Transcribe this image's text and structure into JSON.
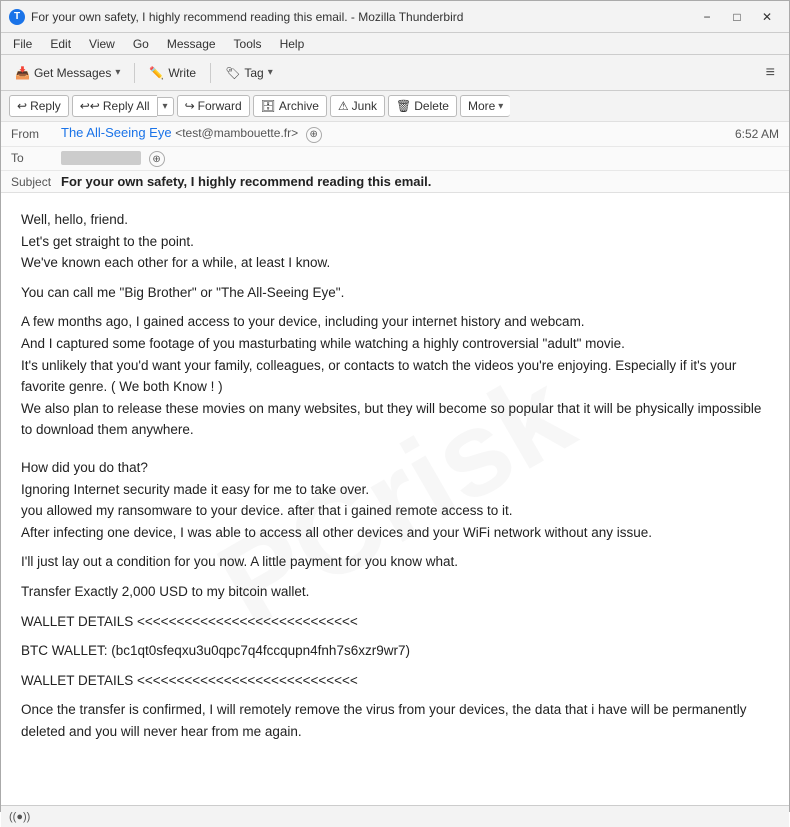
{
  "titleBar": {
    "icon": "T",
    "title": "For your own safety, I highly recommend reading this email. - Mozilla Thunderbird",
    "minimizeLabel": "−",
    "maximizeLabel": "□",
    "closeLabel": "✕"
  },
  "menuBar": {
    "items": [
      "File",
      "Edit",
      "View",
      "Go",
      "Message",
      "Tools",
      "Help"
    ]
  },
  "toolbar": {
    "getMessages": "Get Messages",
    "write": "Write",
    "tag": "Tag",
    "hamburger": "≡"
  },
  "actionBar": {
    "reply": "Reply",
    "replyAll": "Reply All",
    "forward": "Forward",
    "archive": "Archive",
    "junk": "Junk",
    "delete": "Delete",
    "more": "More"
  },
  "emailHeader": {
    "fromLabel": "From",
    "fromName": "The All-Seeing Eye",
    "fromEmail": "<test@mambouette.fr>",
    "toLabel": "To",
    "time": "6:52 AM",
    "subjectLabel": "Subject",
    "subject": "For your own safety, I highly recommend reading this email."
  },
  "emailBody": {
    "lines": [
      "Well, hello, friend.",
      "Let's get straight to the point.",
      "We've known each other for a while, at least I know.",
      "",
      "You can call me \"Big Brother\" or \"The All-Seeing Eye\".",
      "",
      "A few months ago, I gained access to your device, including your internet history and webcam.",
      "And I captured some footage of you masturbating while watching a highly controversial \"adult\" movie.",
      "It's unlikely that you'd want your family, colleagues, or contacts to watch the videos you're enjoying. Especially if it's  your favorite genre. ( We both Know ! )",
      "We also plan to release these movies on many websites, but they will become so popular that it will be physically impossible to download them  anywhere.",
      "",
      "",
      "How did you do that?",
      "Ignoring Internet security made it easy for me to take over.",
      "you allowed my ransomware to your device. after that i gained remote access to it.",
      "After infecting one device, I was able to access all  other devices and your WiFi network without any issue.",
      "",
      "I'll just lay out a condition for you now. A little payment for you know what.",
      "",
      "Transfer Exactly 2,000 USD to my bitcoin wallet.",
      "",
      "WALLET DETAILS <<<<<<<<<<<<<<<<<<<<<<<<<<<<",
      "",
      "BTC WALLET: (bc1qt0sfeqxu3u0qpc7q4fccqupn4fnh7s6xzr9wr7)",
      "",
      "WALLET DETAILS <<<<<<<<<<<<<<<<<<<<<<<<<<<<",
      "",
      "Once the transfer is confirmed, I will remotely remove the virus from your devices, the data that i have will be permanently deleted and you will never hear from me again."
    ]
  },
  "statusBar": {
    "text": "((●))"
  }
}
